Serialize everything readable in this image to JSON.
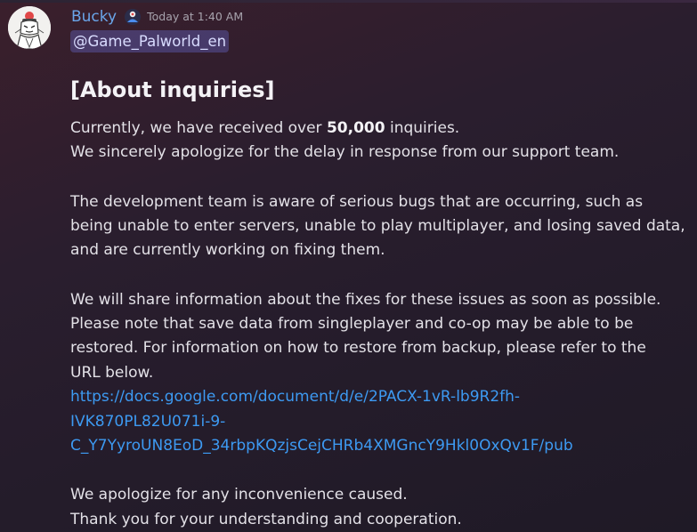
{
  "message": {
    "author": "Bucky",
    "timestamp": "Today at 1:40 AM",
    "mention": "@Game_Palworld_en",
    "heading": "[About inquiries]",
    "p1": {
      "before": "Currently, we have received over ",
      "count": "50,000",
      "after": " inquiries."
    },
    "p1_line2": "We sincerely apologize for the delay in response from our support team.",
    "p2": [
      "The development team is aware of serious bugs that are occurring, such as",
      "being unable to enter servers, unable to play multiplayer, and losing saved data,",
      "and are currently working on fixing them."
    ],
    "p3": [
      "We will share information about the fixes for these issues as soon as possible.",
      "Please note that save data from singleplayer and co-op may be able to be",
      "restored. For information on how to restore from backup, please refer to the",
      "URL below."
    ],
    "link_lines": [
      "https://docs.google.com/document/d/e/2PACX-1vR-lb9R2fh-",
      "IVK870PL82U071i-9-",
      "C_Y7YyroUN8EoD_34rbpKQzjsCejCHRb4XMGncY9Hkl0OxQv1F/pub"
    ],
    "p4": [
      "We apologize for any inconvenience caused.",
      "Thank you for your understanding and cooperation."
    ]
  },
  "icons": {
    "avatar": "bucky-avatar",
    "badge": "app-badge-icon"
  },
  "colors": {
    "username": "#6aa6ea",
    "link": "#3d9af2",
    "mention_bg": "#6c70de"
  }
}
